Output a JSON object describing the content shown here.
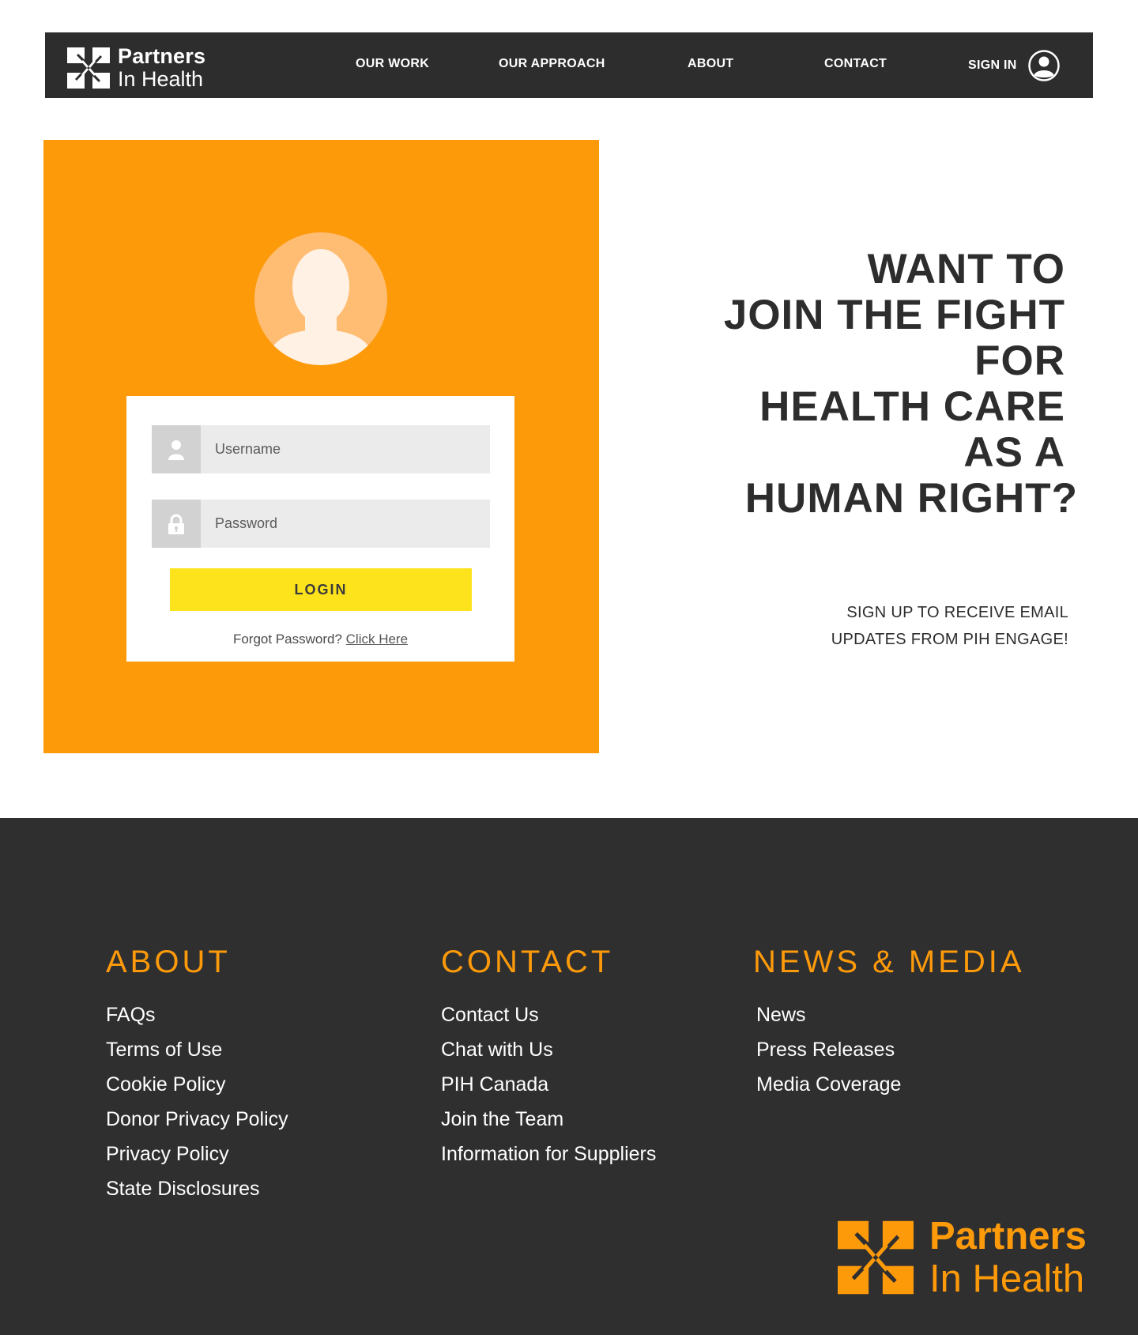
{
  "brand": {
    "name_line1": "Partners",
    "name_line2": "In Health",
    "nav_color": "#2d2d2e",
    "accent": "#fd9a0a",
    "button_color": "#fde31c"
  },
  "nav": {
    "items": [
      {
        "label": "OUR WORK"
      },
      {
        "label": "OUR APPROACH"
      },
      {
        "label": "ABOUT"
      },
      {
        "label": "CONTACT"
      }
    ],
    "sign_in_label": "SIGN IN",
    "sign_in_icon": "user-circle-icon"
  },
  "login": {
    "avatar_icon": "user-silhouette-icon",
    "username": {
      "placeholder": "Username",
      "value": "",
      "icon": "user-icon"
    },
    "password": {
      "placeholder": "Password",
      "value": "",
      "icon": "lock-icon"
    },
    "button_label": "LOGIN",
    "forgot_text": "Forgot Password?",
    "forgot_link": "Click Here"
  },
  "hero": {
    "headline_lines": [
      "WANT TO",
      "JOIN THE FIGHT",
      "FOR",
      "HEALTH CARE",
      "AS A",
      "HUMAN RIGHT?"
    ],
    "subline_lines": [
      "SIGN UP TO RECEIVE EMAIL",
      "UPDATES FROM PIH ENGAGE!"
    ]
  },
  "footer": {
    "columns": [
      {
        "title": "ABOUT",
        "links": [
          "FAQs",
          "Terms of Use",
          "Cookie Policy",
          "Donor Privacy Policy",
          "Privacy Policy",
          "State Disclosures"
        ]
      },
      {
        "title": "CONTACT",
        "links": [
          "Contact Us",
          "Chat with Us",
          "PIH Canada",
          "Join the Team",
          "Information for Suppliers"
        ]
      },
      {
        "title": "NEWS & MEDIA",
        "links": [
          "News",
          "Press Releases",
          "Media Coverage"
        ]
      }
    ]
  }
}
